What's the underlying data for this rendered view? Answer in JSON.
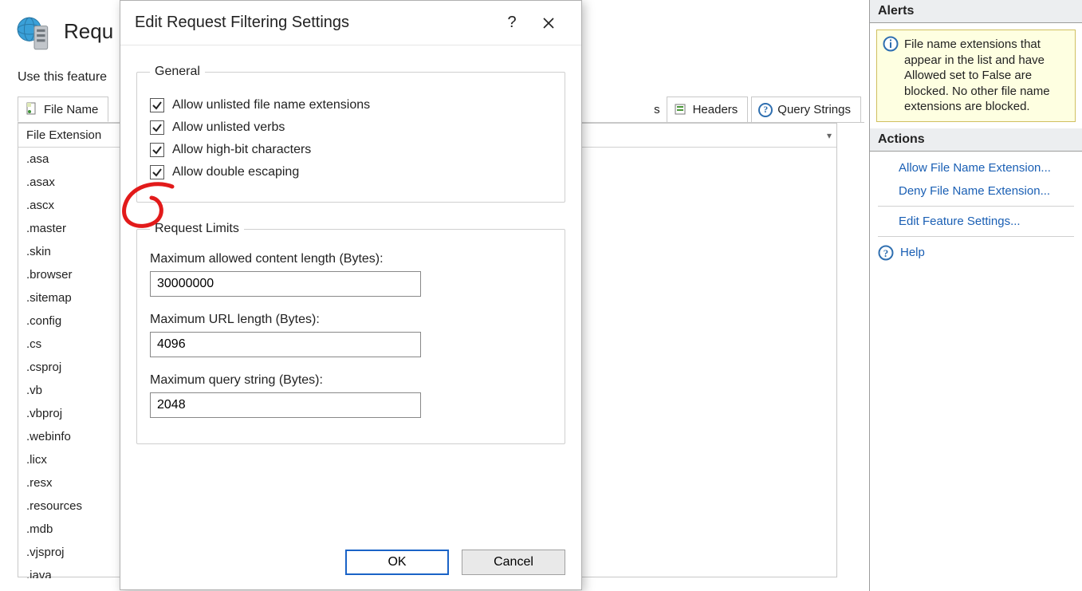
{
  "page": {
    "title": "Requ",
    "subtitle": "Use this feature"
  },
  "tabs": {
    "file_ext": "File Name",
    "headers": "Headers",
    "query": "Query Strings"
  },
  "list": {
    "header": "File Extension",
    "items": [
      ".asa",
      ".asax",
      ".ascx",
      ".master",
      ".skin",
      ".browser",
      ".sitemap",
      ".config",
      ".cs",
      ".csproj",
      ".vb",
      ".vbproj",
      ".webinfo",
      ".licx",
      ".resx",
      ".resources",
      ".mdb",
      ".vjsproj",
      ".java"
    ]
  },
  "alerts": {
    "header": "Alerts",
    "text": "File name extensions that appear in the list and have Allowed set to False are blocked. No other file name extensions are blocked."
  },
  "actions": {
    "header": "Actions",
    "allow": "Allow File Name Extension...",
    "deny": "Deny File Name Extension...",
    "edit": "Edit Feature Settings...",
    "help": "Help"
  },
  "dialog": {
    "title": "Edit Request Filtering Settings",
    "help": "?",
    "general": {
      "legend": "General",
      "allow_unlisted_ext": "Allow unlisted file name extensions",
      "allow_unlisted_verbs": "Allow unlisted verbs",
      "allow_highbit": "Allow high-bit characters",
      "allow_double_escaping": "Allow double escaping"
    },
    "limits": {
      "legend": "Request Limits",
      "max_content_label": "Maximum allowed content length (Bytes):",
      "max_content_value": "30000000",
      "max_url_label": "Maximum URL length (Bytes):",
      "max_url_value": "4096",
      "max_query_label": "Maximum query string (Bytes):",
      "max_query_value": "2048"
    },
    "ok": "OK",
    "cancel": "Cancel"
  }
}
